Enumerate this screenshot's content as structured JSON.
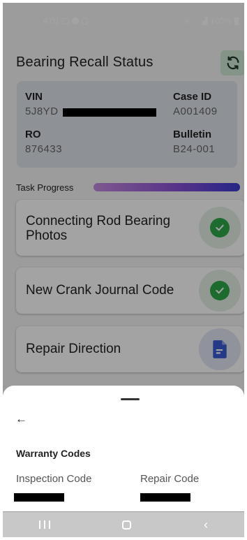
{
  "status_bar": {
    "time": "4:01",
    "battery": "100%"
  },
  "header": {
    "title": "Bearing Recall Status",
    "refresh_icon": "refresh-icon"
  },
  "vehicle_info": {
    "vin_label": "VIN",
    "vin_value": "5J8YD",
    "case_id_label": "Case ID",
    "case_id_value": "A001409",
    "ro_label": "RO",
    "ro_value": "876433",
    "bulletin_label": "Bulletin",
    "bulletin_value": "B24-001"
  },
  "progress": {
    "label": "Task Progress",
    "fraction": 1.0,
    "colors": [
      "#c48ce0",
      "#8c52d6",
      "#3b3bd4"
    ]
  },
  "tasks": [
    {
      "title": "Connecting Rod Bearing Photos",
      "status": "complete",
      "icon": "check-icon"
    },
    {
      "title": "New Crank Journal Code",
      "status": "complete",
      "icon": "check-icon"
    },
    {
      "title": "Repair Direction",
      "status": "pending",
      "icon": "document-icon"
    }
  ],
  "sheet": {
    "back_icon": "arrow-left-icon",
    "heading": "Warranty Codes",
    "inspection_label": "Inspection Code",
    "repair_label": "Repair Code"
  },
  "colors": {
    "success": "#2ea84a",
    "accent_blue": "#3b5bd4",
    "card_bg": "#dfe3ea"
  }
}
